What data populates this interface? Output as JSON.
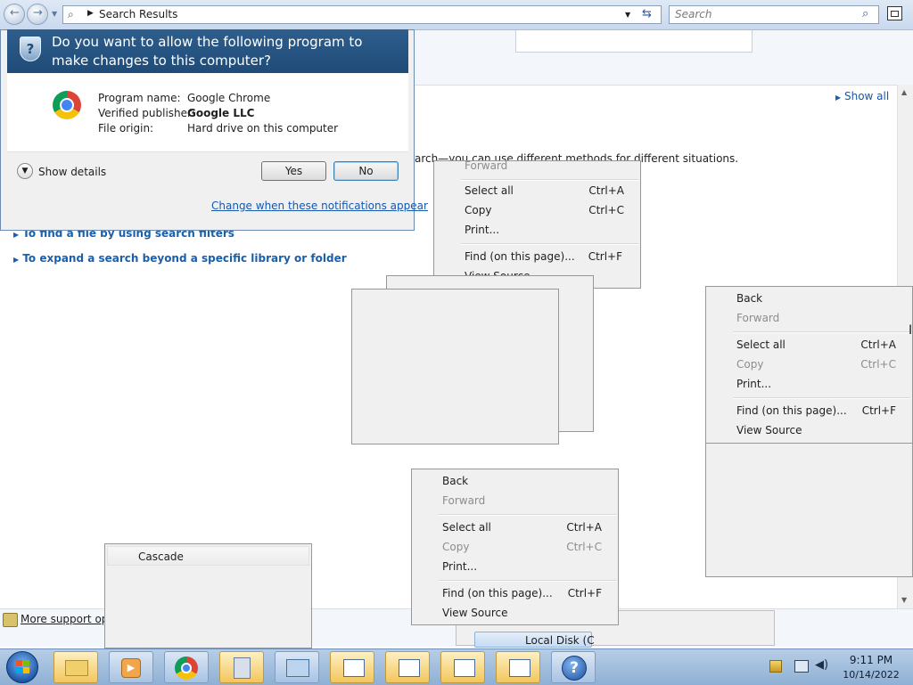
{
  "explorer": {
    "breadcrumb": "Search Results",
    "search_placeholder": "Search",
    "show_all": "Show all",
    "intro_text": "arch—you can use different methods for different situations.",
    "links": [
      "To find a file by using search filters",
      "To expand a search beyond a specific library or folder"
    ],
    "more_support": "More support opt",
    "local_disk": "Local Disk (C"
  },
  "uac": {
    "question": "Do you want to allow the following program to make changes to this computer?",
    "program_label": "Program name:",
    "program_value": "Google Chrome",
    "publisher_label": "Verified publisher:",
    "publisher_value": "Google LLC",
    "origin_label": "File origin:",
    "origin_value": "Hard drive on this computer",
    "show_details": "Show details",
    "yes": "Yes",
    "no": "No",
    "change_link": "Change when these notifications appear"
  },
  "menu_top": {
    "partial_item": "Forward",
    "items": [
      {
        "label": "Select all",
        "shortcut": "Ctrl+A"
      },
      {
        "label": "Copy",
        "shortcut": "Ctrl+C"
      },
      {
        "label": "Print...",
        "shortcut": ""
      },
      {
        "label": "Find (on this page)...",
        "shortcut": "Ctrl+F"
      },
      {
        "label": "View Source",
        "shortcut": ""
      }
    ]
  },
  "menu_right": {
    "back": "Back",
    "forward": "Forward",
    "select_all": "Select all",
    "select_all_sc": "Ctrl+A",
    "copy": "Copy",
    "copy_sc": "Ctrl+C",
    "print": "Print...",
    "find": "Find (on this page)...",
    "find_sc": "Ctrl+F",
    "view_source": "View Source"
  },
  "menu_bottom": {
    "back": "Back",
    "forward": "Forward",
    "select_all": "Select all",
    "select_all_sc": "Ctrl+A",
    "copy": "Copy",
    "copy_sc": "Ctrl+C",
    "print": "Print...",
    "find": "Find (on this page)...",
    "find_sc": "Ctrl+F",
    "view_source": "View Source"
  },
  "menu_cascade": {
    "item": "Cascade"
  },
  "taskbar": {
    "time": "9:11 PM",
    "date": "10/14/2022",
    "buttons": [
      "windows-explorer",
      "media-player",
      "chrome",
      "calculator",
      "control-panel",
      "window-1",
      "window-2",
      "window-3",
      "window-4",
      "help"
    ]
  }
}
